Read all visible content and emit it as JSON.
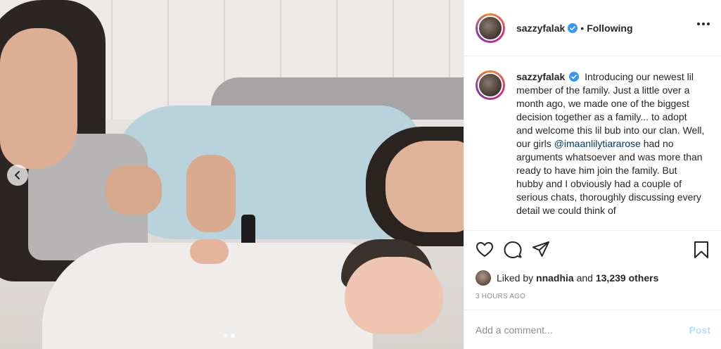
{
  "post": {
    "username": "sazzyfalak",
    "follow_status": "Following",
    "bullet": "•",
    "caption": "Introducing our newest lil member of the family. Just a little over a month ago, we made one of the biggest decision together as a family... to adopt and welcome this lil bub into our clan. Well, our girls",
    "caption_mention": "@imaanlilytiararose",
    "caption_continued": "had no arguments whatsoever and was more than ready to have him join the family. But hubby and I obviously had a couple of serious chats, thoroughly discussing every detail we could think of",
    "likes": {
      "prefix": "Liked by",
      "liker": "nnadhia",
      "connector": "and",
      "others": "13,239 others"
    },
    "timestamp": "3 HOURS AGO"
  },
  "comment_box": {
    "placeholder": "Add a comment...",
    "post_label": "Post"
  },
  "carousel": {
    "current_index": 2,
    "total": 2
  },
  "icons": {
    "verified": "verified-badge-icon",
    "like": "heart-icon",
    "comment": "comment-icon",
    "share": "share-icon",
    "save": "bookmark-icon",
    "more": "more-options-icon",
    "prev": "chevron-left-icon"
  },
  "colors": {
    "verified_blue": "#3897f0",
    "mention": "#00376b",
    "post_disabled": "#b2dffc",
    "muted": "#8e8e8e"
  }
}
